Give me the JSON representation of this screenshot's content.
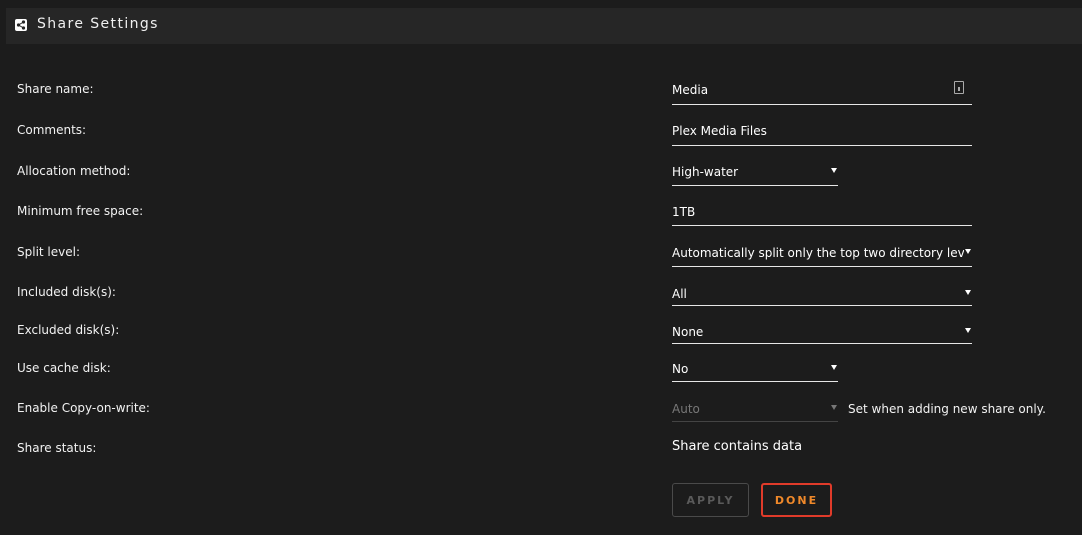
{
  "header": {
    "title": "Share Settings",
    "icon": "share-icon"
  },
  "fields": {
    "share_name": {
      "label": "Share name:",
      "value": "Media"
    },
    "comments": {
      "label": "Comments:",
      "value": "Plex Media Files"
    },
    "allocation": {
      "label": "Allocation method:",
      "value": "High-water"
    },
    "min_free": {
      "label": "Minimum free space:",
      "value": "1TB"
    },
    "split_level": {
      "label": "Split level:",
      "value": "Automatically split only the top two directory levels"
    },
    "included": {
      "label": "Included disk(s):",
      "value": "All"
    },
    "excluded": {
      "label": "Excluded disk(s):",
      "value": "None"
    },
    "use_cache": {
      "label": "Use cache disk:",
      "value": "No"
    },
    "cow": {
      "label": "Enable Copy-on-write:",
      "value": "Auto",
      "note": "Set when adding new share only."
    },
    "status": {
      "label": "Share status:",
      "value": "Share contains data"
    }
  },
  "buttons": {
    "apply": "APPLY",
    "done": "DONE"
  },
  "colors": {
    "background": "#1c1c1c",
    "header": "#262626",
    "done_border": "#e03b2a",
    "done_text": "#f0892a"
  }
}
